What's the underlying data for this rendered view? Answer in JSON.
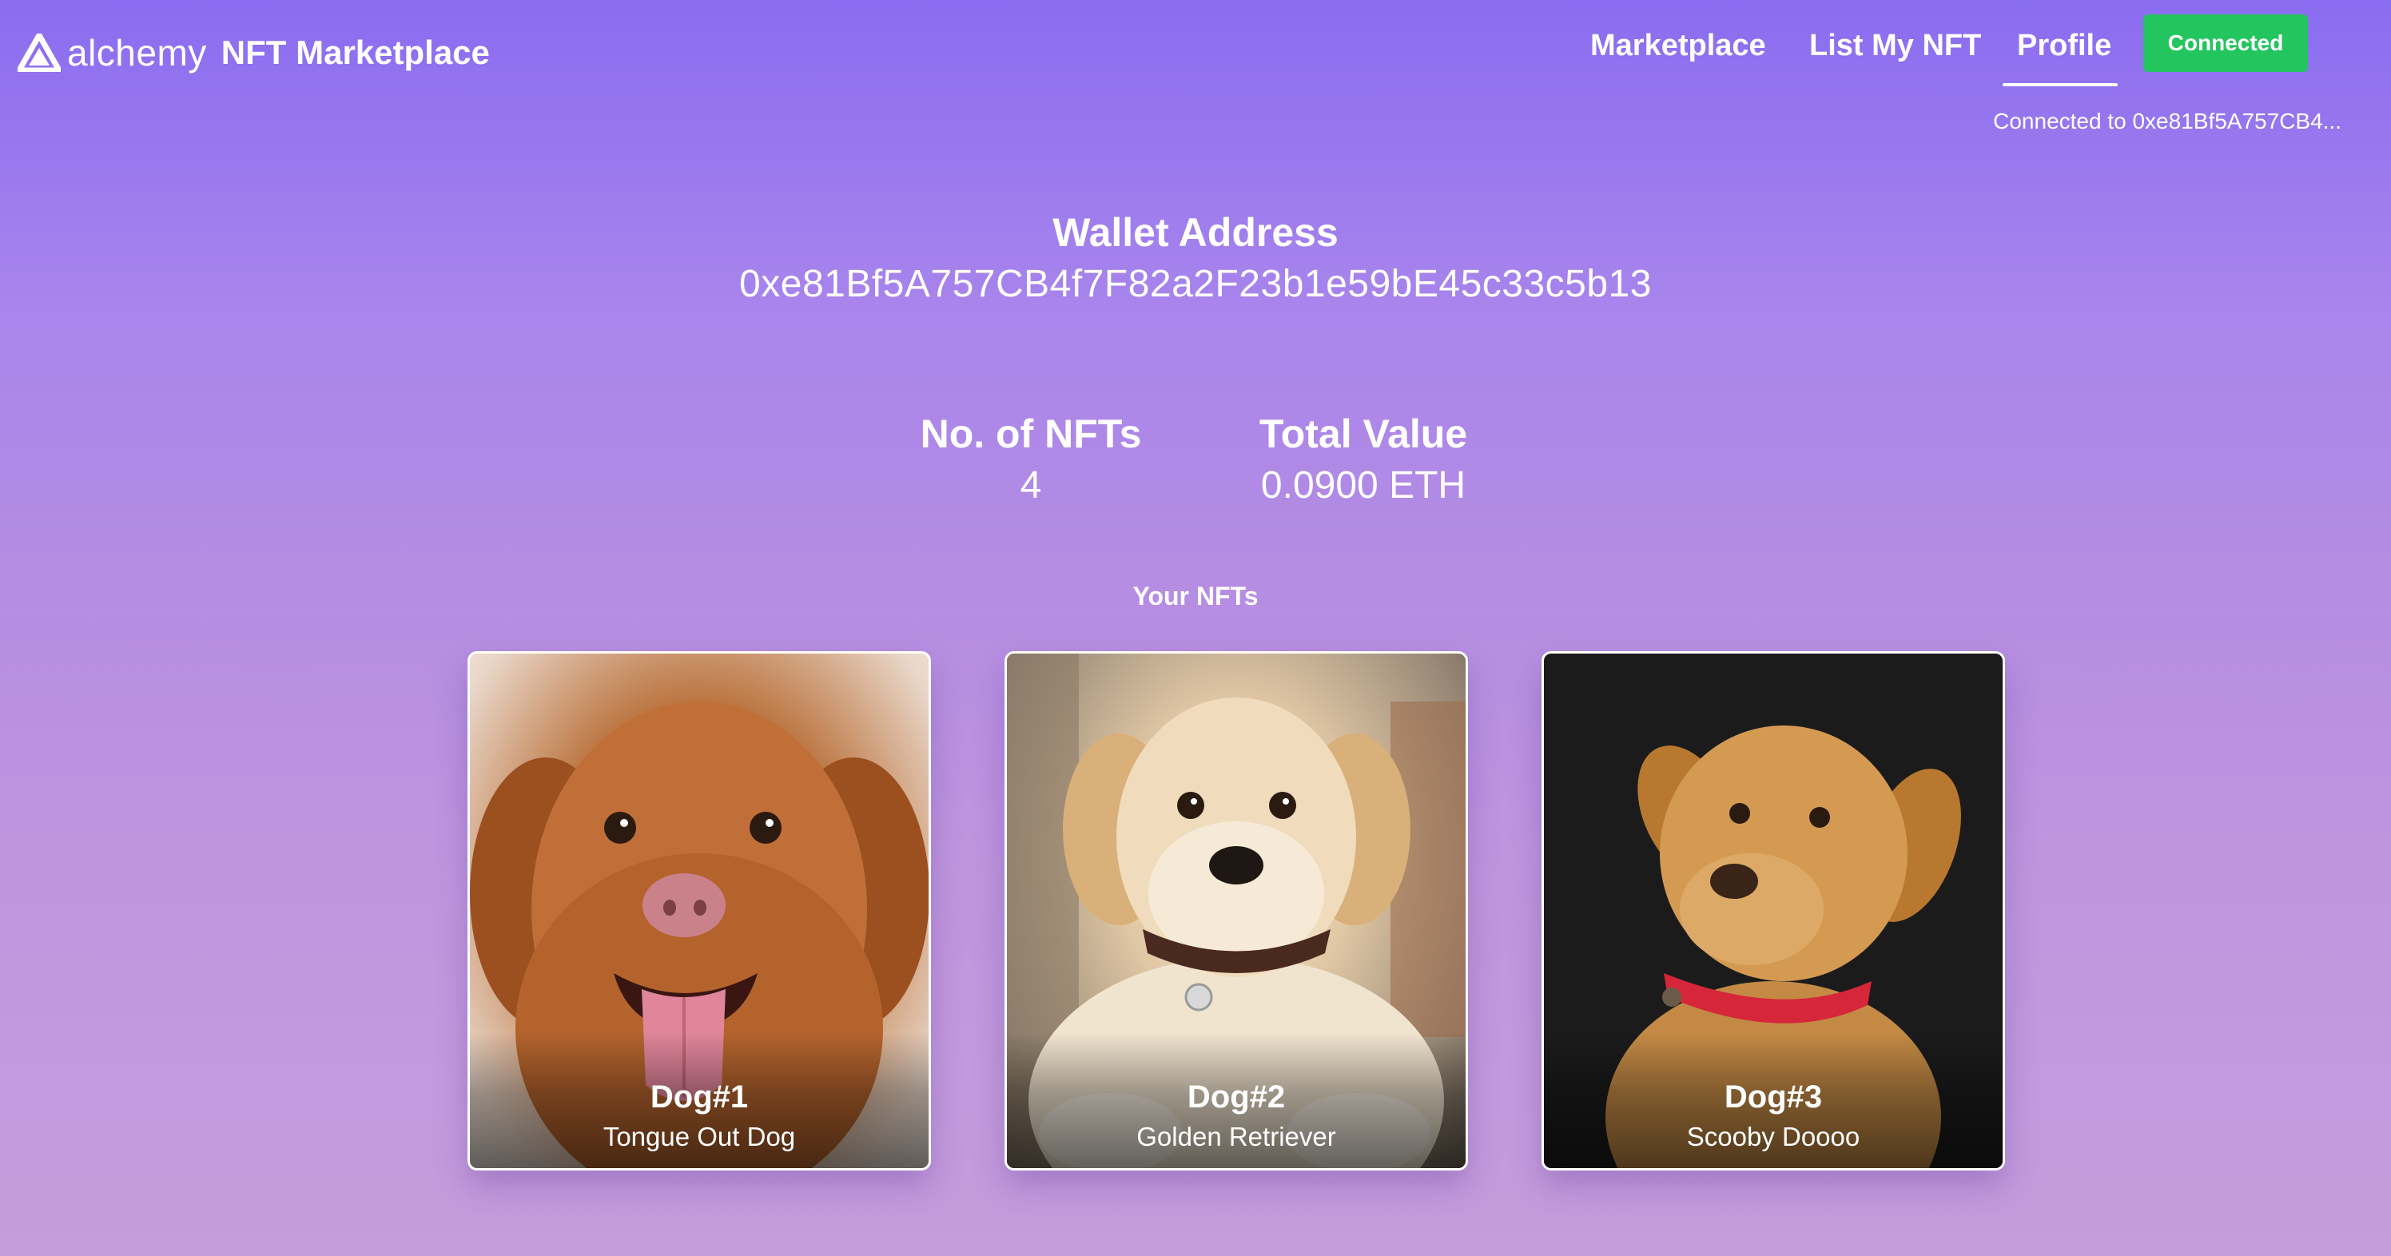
{
  "navbar": {
    "brand_word": "alchemy",
    "brand_title": "NFT Marketplace",
    "links": {
      "marketplace": "Marketplace",
      "list_my_nft": "List My NFT",
      "profile": "Profile"
    },
    "active_link": "Profile",
    "connect_button": "Connected",
    "connected_to": "Connected to 0xe81Bf5A757CB4...",
    "colors": {
      "connect_button": "#22c55e",
      "background_top": "#8a6cf0",
      "background_bottom": "#c59ddc"
    }
  },
  "wallet": {
    "label": "Wallet Address",
    "address": "0xe81Bf5A757CB4f7F82a2F23b1e59bE45c33c5b13"
  },
  "stats": {
    "nfts_label": "No. of NFTs",
    "nfts_count": "4",
    "value_label": "Total Value",
    "value_amount": "0.0900 ETH"
  },
  "nfts": {
    "section_title": "Your NFTs",
    "items": [
      {
        "name": "Dog#1",
        "description": "Tongue Out Dog",
        "image": "dog-photo-tongue-out"
      },
      {
        "name": "Dog#2",
        "description": "Golden Retriever",
        "image": "dog-photo-golden-puppy"
      },
      {
        "name": "Dog#3",
        "description": "Scooby Doooo",
        "image": "dog-photo-labrador"
      }
    ]
  }
}
